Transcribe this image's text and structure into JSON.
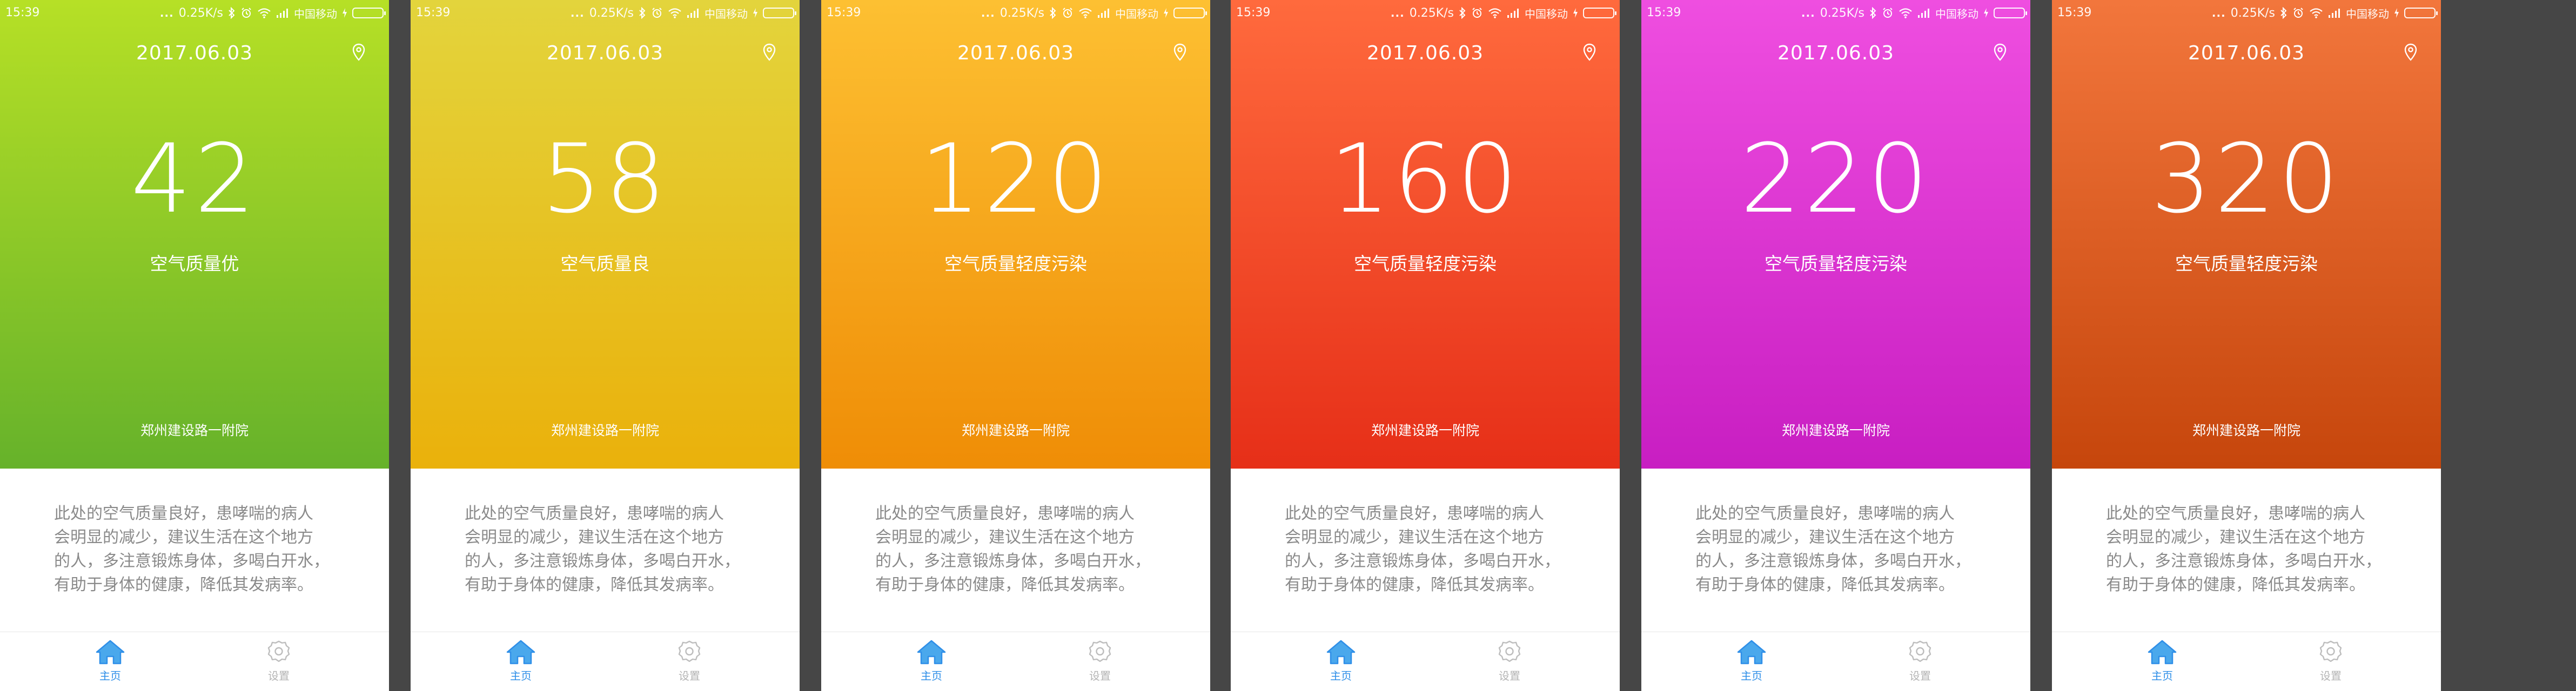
{
  "status_bar": {
    "time": "15:39",
    "dots": "...",
    "speed": "0.25K/s",
    "carrier": "中国移动",
    "icons": [
      "bluetooth-icon",
      "alarm-icon",
      "wifi-icon",
      "signal-icon",
      "battery-icon"
    ]
  },
  "screens": [
    {
      "date": "2017.06.03",
      "aqi": "42",
      "level": "空气质量优",
      "location": "郑州建设路一附院",
      "gradient": [
        "#b6e026",
        "#66b22a"
      ],
      "advice": [
        "此处的空气质量良好，患哮喘的病人",
        "会明显的减少，建议生活在这个地方",
        "的人，多注意锻炼身体，多喝白开水，",
        "有助于身体的健康，降低其发病率。"
      ]
    },
    {
      "date": "2017.06.03",
      "aqi": "58",
      "level": "空气质量良",
      "location": "郑州建设路一附院",
      "gradient": [
        "#e3d43c",
        "#eab10b"
      ],
      "advice": [
        "此处的空气质量良好，患哮喘的病人",
        "会明显的减少，建议生活在这个地方",
        "的人，多注意锻炼身体，多喝白开水，",
        "有助于身体的健康，降低其发病率。"
      ]
    },
    {
      "date": "2017.06.03",
      "aqi": "120",
      "level": "空气质量轻度污染",
      "location": "郑州建设路一附院",
      "gradient": [
        "#fdc032",
        "#ef8d06"
      ],
      "advice": [
        "此处的空气质量良好，患哮喘的病人",
        "会明显的减少，建议生活在这个地方",
        "的人，多注意锻炼身体，多喝白开水，",
        "有助于身体的健康，降低其发病率。"
      ]
    },
    {
      "date": "2017.06.03",
      "aqi": "160",
      "level": "空气质量轻度污染",
      "location": "郑州建设路一附院",
      "gradient": [
        "#ff6a3d",
        "#e62f18"
      ],
      "advice": [
        "此处的空气质量良好，患哮喘的病人",
        "会明显的减少，建议生活在这个地方",
        "的人，多注意锻炼身体，多喝白开水，",
        "有助于身体的健康，降低其发病率。"
      ]
    },
    {
      "date": "2017.06.03",
      "aqi": "220",
      "level": "空气质量轻度污染",
      "location": "郑州建设路一附院",
      "gradient": [
        "#ef4ee0",
        "#c81ec2"
      ],
      "advice": [
        "此处的空气质量良好，患哮喘的病人",
        "会明显的减少，建议生活在这个地方",
        "的人，多注意锻炼身体，多喝白开水，",
        "有助于身体的健康，降低其发病率。"
      ]
    },
    {
      "date": "2017.06.03",
      "aqi": "320",
      "level": "空气质量轻度污染",
      "location": "郑州建设路一附院",
      "gradient": [
        "#f2763c",
        "#c6460c"
      ],
      "advice": [
        "此处的空气质量良好，患哮喘的病人",
        "会明显的减少，建议生活在这个地方",
        "的人，多注意锻炼身体，多喝白开水，",
        "有助于身体的健康，降低其发病率。"
      ]
    }
  ],
  "tabs": {
    "home_label": "主页",
    "home_icon": "home-icon",
    "settings_label": "设置",
    "settings_icon": "gear-icon",
    "active_color": "#2f8fe8",
    "inactive_color": "#b4b4b4"
  }
}
